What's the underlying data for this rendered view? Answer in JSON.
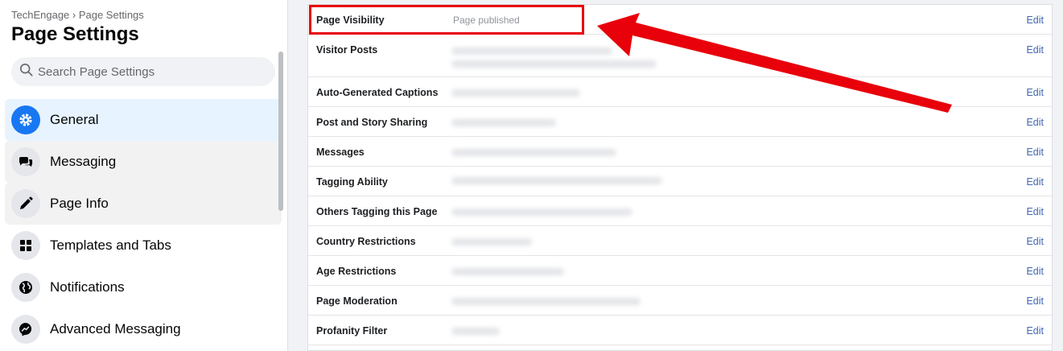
{
  "sidebar": {
    "breadcrumb": "TechEngage › Page Settings",
    "title": "Page Settings",
    "search_placeholder": "Search Page Settings",
    "items": [
      {
        "label": "General",
        "icon": "gear-icon",
        "state": "active"
      },
      {
        "label": "Messaging",
        "icon": "chat-bubbles-icon",
        "state": "hover"
      },
      {
        "label": "Page Info",
        "icon": "pencil-icon",
        "state": "hover"
      },
      {
        "label": "Templates and Tabs",
        "icon": "grid-icon",
        "state": "normal"
      },
      {
        "label": "Notifications",
        "icon": "globe-icon",
        "state": "normal"
      },
      {
        "label": "Advanced Messaging",
        "icon": "messenger-icon",
        "state": "normal"
      }
    ]
  },
  "settings": {
    "edit_label": "Edit",
    "rows": [
      {
        "label": "Page Visibility",
        "value": "Page published"
      },
      {
        "label": "Visitor Posts",
        "value": ""
      },
      {
        "label": "Auto-Generated Captions",
        "value": ""
      },
      {
        "label": "Post and Story Sharing",
        "value": ""
      },
      {
        "label": "Messages",
        "value": ""
      },
      {
        "label": "Tagging Ability",
        "value": ""
      },
      {
        "label": "Others Tagging this Page",
        "value": ""
      },
      {
        "label": "Country Restrictions",
        "value": ""
      },
      {
        "label": "Age Restrictions",
        "value": ""
      },
      {
        "label": "Page Moderation",
        "value": ""
      },
      {
        "label": "Profanity Filter",
        "value": ""
      }
    ]
  },
  "colors": {
    "accent": "#1877f2",
    "link": "#4267b2",
    "annotation": "#e8000b"
  }
}
